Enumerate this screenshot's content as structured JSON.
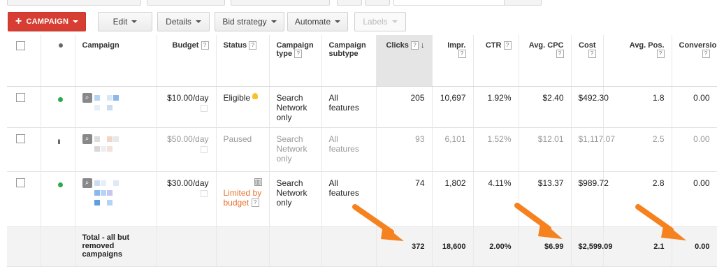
{
  "toolbar": {
    "campaign_label": "CAMPAIGN",
    "edit_label": "Edit",
    "details_label": "Details",
    "bid_strategy_label": "Bid strategy",
    "automate_label": "Automate",
    "labels_label": "Labels"
  },
  "table": {
    "headers": {
      "campaign": "Campaign",
      "budget": "Budget",
      "status": "Status",
      "campaign_type": "Campaign type",
      "campaign_subtype": "Campaign subtype",
      "clicks": "Clicks",
      "impr": "Impr.",
      "ctr": "CTR",
      "avg_cpc": "Avg. CPC",
      "cost": "Cost",
      "avg_pos": "Avg. Pos.",
      "conversions": "Conversions"
    },
    "help_glyph": "?",
    "sort_arrow": "↓",
    "rows": [
      {
        "budget": "$10.00/day",
        "status": "Eligible",
        "type": "Search Network only",
        "subtype": "All features",
        "clicks": "205",
        "impr": "10,697",
        "ctr": "1.92%",
        "avg_cpc": "$2.40",
        "cost": "$492.30",
        "avg_pos": "1.8",
        "conversions": "0.00"
      },
      {
        "budget": "$50.00/day",
        "status": "Paused",
        "type": "Search Network only",
        "subtype": "All features",
        "clicks": "93",
        "impr": "6,101",
        "ctr": "1.52%",
        "avg_cpc": "$12.01",
        "cost": "$1,117.07",
        "avg_pos": "2.5",
        "conversions": "0.00"
      },
      {
        "budget": "$30.00/day",
        "status": "Limited by budget",
        "type": "Search Network only",
        "subtype": "All features",
        "clicks": "74",
        "impr": "1,802",
        "ctr": "4.11%",
        "avg_cpc": "$13.37",
        "cost": "$989.72",
        "avg_pos": "2.8",
        "conversions": "0.00"
      }
    ],
    "total": {
      "label": "Total - all but removed campaigns",
      "clicks": "372",
      "impr": "18,600",
      "ctr": "2.00%",
      "avg_cpc": "$6.99",
      "cost": "$2,599.09",
      "avg_pos": "2.1",
      "conversions": "0.00"
    }
  },
  "colors": {
    "campaign_button": "#d73d32",
    "enabled_dot": "#2eaa4c",
    "paused_status": "#e8702a",
    "arrow": "#f5821f"
  },
  "icons": [
    "plus-icon",
    "caret-down-icon",
    "magnifier-icon",
    "status-dot-icon",
    "pause-icon",
    "lightbulb-icon",
    "bar-chart-icon",
    "help-icon",
    "sort-arrow-icon"
  ]
}
